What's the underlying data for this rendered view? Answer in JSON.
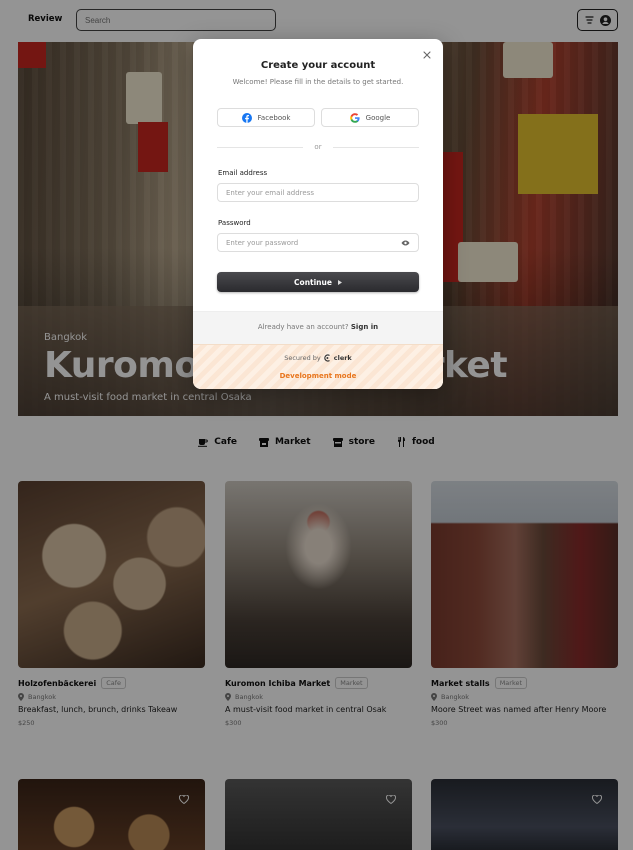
{
  "header": {
    "brand": "Review",
    "search_placeholder": "Search"
  },
  "hero": {
    "city": "Bangkok",
    "title": "Kuromon Ichiba Market",
    "subtitle": "A must-visit food market in central Osaka"
  },
  "categories": [
    {
      "label": "Cafe",
      "icon": "coffee-cup-icon"
    },
    {
      "label": "Market",
      "icon": "shop-icon"
    },
    {
      "label": "store",
      "icon": "store-icon"
    },
    {
      "label": "food",
      "icon": "utensils-icon"
    }
  ],
  "cards": [
    {
      "name": "Holzofenbäckerei",
      "tag": "Cafe",
      "location": "Bangkok",
      "description": "Breakfast, lunch, brunch, drinks Takeaw",
      "price": "$250"
    },
    {
      "name": "Kuromon Ichiba Market",
      "tag": "Market",
      "location": "Bangkok",
      "description": "A must-visit food market in central Osak",
      "price": "$300"
    },
    {
      "name": "Market stalls",
      "tag": "Market",
      "location": "Bangkok",
      "description": "Moore Street was named after Henry Moore",
      "price": "$300"
    }
  ],
  "modal": {
    "title": "Create your account",
    "subtitle": "Welcome! Please fill in the details to get started.",
    "facebook_label": "Facebook",
    "google_label": "Google",
    "divider": "or",
    "email_label": "Email address",
    "email_placeholder": "Enter your email address",
    "password_label": "Password",
    "password_placeholder": "Enter your password",
    "continue_label": "Continue",
    "have_account": "Already have an account?",
    "sign_in": "Sign in",
    "secured_by": "Secured by",
    "clerk": "clerk",
    "dev_mode": "Development mode"
  },
  "colors": {
    "overlay": "#000000",
    "facebook": "#1877f2",
    "dev_mode": "#e8761e"
  }
}
